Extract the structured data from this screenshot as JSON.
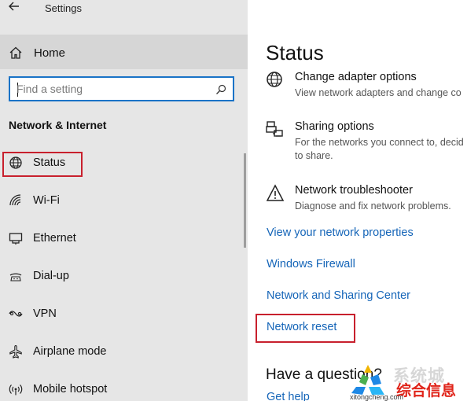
{
  "window": {
    "title": "Settings"
  },
  "sidebar": {
    "home_label": "Home",
    "search_placeholder": "Find a setting",
    "section_title": "Network & Internet",
    "items": [
      {
        "label": "Status",
        "icon": "globe-icon"
      },
      {
        "label": "Wi-Fi",
        "icon": "wifi-icon"
      },
      {
        "label": "Ethernet",
        "icon": "ethernet-icon"
      },
      {
        "label": "Dial-up",
        "icon": "dialup-icon"
      },
      {
        "label": "VPN",
        "icon": "vpn-icon"
      },
      {
        "label": "Airplane mode",
        "icon": "airplane-icon"
      },
      {
        "label": "Mobile hotspot",
        "icon": "hotspot-icon"
      }
    ]
  },
  "main": {
    "title": "Status",
    "settings": [
      {
        "title": "Change adapter options",
        "desc": "View network adapters and change co",
        "icon": "globe-icon"
      },
      {
        "title": "Sharing options",
        "desc": "For the networks you connect to, decid to share.",
        "icon": "printer-share-icon"
      },
      {
        "title": "Network troubleshooter",
        "desc": "Diagnose and fix network problems.",
        "icon": "warning-icon"
      }
    ],
    "links": [
      "View your network properties",
      "Windows Firewall",
      "Network and Sharing Center",
      "Network reset"
    ],
    "question": "Have a question?",
    "help_link": "Get help"
  },
  "watermark": {
    "brand_top": "系统城",
    "brand_bottom": "综合信息",
    "url": "xitongcheng.com"
  },
  "colors": {
    "accent": "#1a73c7",
    "link": "#1565b8",
    "highlight": "#c8202d",
    "sidebar_bg": "#e6e6e6"
  }
}
